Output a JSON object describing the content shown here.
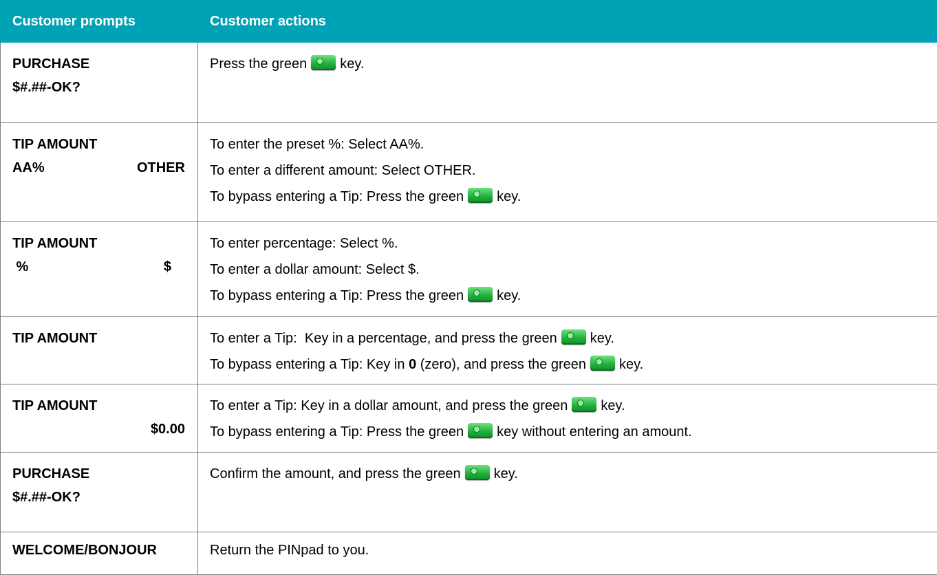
{
  "table": {
    "headers": {
      "prompts": "Customer prompts",
      "actions": "Customer actions"
    },
    "rows": [
      {
        "prompt": {
          "line1": "PURCHASE",
          "line2": "$#.##-OK?"
        },
        "actions": [
          {
            "before": "Press the green",
            "after": "key."
          }
        ]
      },
      {
        "prompt": {
          "line1": "TIP AMOUNT",
          "line2_left": "AA%",
          "line2_right": "OTHER"
        },
        "actions": [
          {
            "text": "To enter the preset %: Select AA%."
          },
          {
            "text": "To enter a different amount: Select OTHER."
          },
          {
            "before": "To bypass entering a Tip: Press the green",
            "after": "key."
          }
        ]
      },
      {
        "prompt": {
          "line1": "TIP AMOUNT",
          "line2_left": " %",
          "line2_right": "$"
        },
        "actions": [
          {
            "text": "To enter percentage: Select %."
          },
          {
            "text": "To enter a dollar amount: Select $."
          },
          {
            "before": "To bypass entering a Tip: Press the green",
            "after": "key."
          }
        ]
      },
      {
        "prompt": {
          "line1": "TIP AMOUNT"
        },
        "actions": [
          {
            "before": "To enter a Tip:  Key in a percentage, and press the green",
            "after": "key."
          },
          {
            "before_a": "To bypass entering a Tip: Key in ",
            "bold": "0",
            "before_b": " (zero), and press the green",
            "after": "key."
          }
        ]
      },
      {
        "prompt": {
          "line1": "TIP AMOUNT",
          "line2_right": "$0.00"
        },
        "actions": [
          {
            "before": "To enter a Tip: Key in a dollar amount, and press the green",
            "after": "key."
          },
          {
            "before": "To bypass entering a Tip: Press the green",
            "after": "key without entering an amount."
          }
        ]
      },
      {
        "prompt": {
          "line1": "PURCHASE",
          "line2": "$#.##-OK?"
        },
        "actions": [
          {
            "before": "Confirm the amount, and press the green",
            "after": "key."
          }
        ]
      },
      {
        "prompt": {
          "line1": "WELCOME/BONJOUR"
        },
        "actions": [
          {
            "text": "Return the PINpad to you."
          }
        ]
      }
    ]
  },
  "icons": {
    "green_key": "green-key-icon"
  },
  "colors": {
    "header_background": "#00a2b5",
    "header_text": "#ffffff",
    "border": "#7f7f7f",
    "key_green": "#1fae3b"
  }
}
